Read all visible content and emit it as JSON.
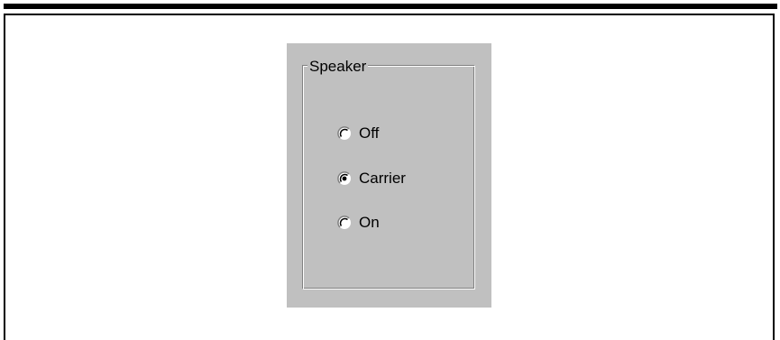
{
  "group": {
    "label": "Speaker"
  },
  "options": [
    {
      "label": "Off",
      "selected": false
    },
    {
      "label": "Carrier",
      "selected": true
    },
    {
      "label": "On",
      "selected": false
    }
  ],
  "colors": {
    "panel": "#c0c0c0",
    "shadow": "#808080",
    "highlight": "#ffffff",
    "border": "#000000"
  }
}
